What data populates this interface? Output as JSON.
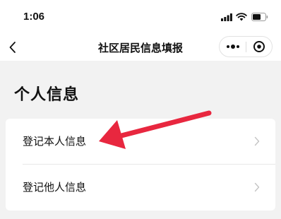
{
  "status_bar": {
    "time": "1:06"
  },
  "nav": {
    "title": "社区居民信息填报"
  },
  "section": {
    "title": "个人信息"
  },
  "menu": {
    "items": [
      {
        "label": "登记本人信息"
      },
      {
        "label": "登记他人信息"
      }
    ]
  },
  "colors": {
    "background": "#f2f2f2",
    "card": "#ffffff",
    "annotation_arrow": "#e8273f"
  },
  "icons": [
    "signal-icon",
    "wifi-icon",
    "battery-icon",
    "back-icon",
    "more-icon",
    "target-icon",
    "chevron-right-icon",
    "annotation-arrow"
  ]
}
